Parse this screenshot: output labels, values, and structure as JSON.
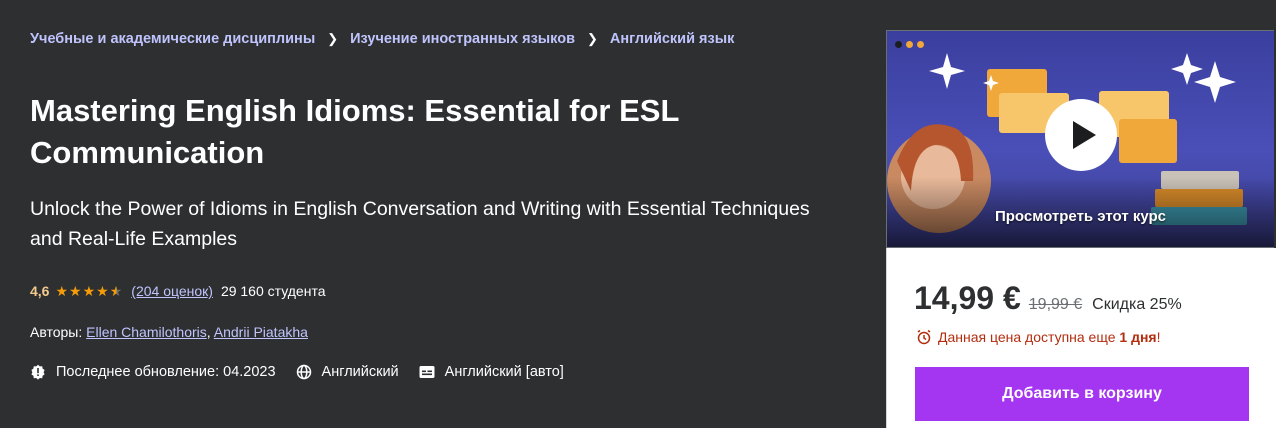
{
  "breadcrumb": [
    {
      "label": "Учебные и академические дисциплины"
    },
    {
      "label": "Изучение иностранных языков"
    },
    {
      "label": "Английский язык"
    }
  ],
  "course": {
    "title": "Mastering English Idioms: Essential for ESL Communication",
    "subtitle": "Unlock the Power of Idioms in English Conversation and Writing with Essential Techniques and Real-Life Examples",
    "rating": "4,6",
    "rating_value": 4.6,
    "rating_max": 5,
    "rating_count": "(204 оценок)",
    "students": "29 160 студента",
    "authors_label": "Авторы:",
    "authors": [
      "Ellen Chamilothoris",
      "Andrii Piatakha"
    ],
    "last_updated": "Последнее обновление: 04.2023",
    "language": "Английский",
    "captions": "Английский [авто]"
  },
  "preview": {
    "caption": "Просмотреть этот курс"
  },
  "purchase": {
    "price": "14,99 €",
    "old_price": "19,99 €",
    "discount": "Скидка 25%",
    "timer_text": "Данная цена доступна еще ",
    "timer_bold": "1 дня",
    "timer_end": "!",
    "add_to_cart": "Добавить в корзину"
  },
  "colors": {
    "background": "#2d2f31",
    "link": "#c0c4fc",
    "star": "#f69c08",
    "rating": "#f3ca8c",
    "cta": "#a435f0",
    "timer": "#b32d0f"
  },
  "icons": {
    "breadcrumb_separator": "chevron-right-icon",
    "update": "alert-badge-icon",
    "language": "globe-icon",
    "captions": "closed-captions-icon",
    "timer": "alarm-clock-icon",
    "play": "play-icon"
  }
}
